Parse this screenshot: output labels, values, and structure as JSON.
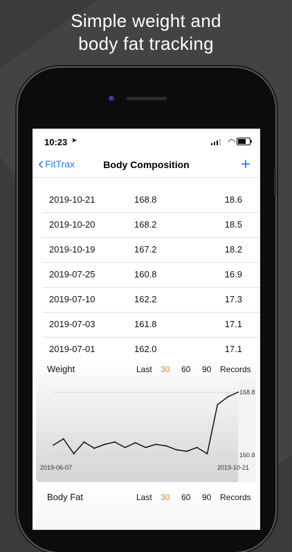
{
  "headline": {
    "line1": "Simple weight and",
    "line2": "body fat tracking"
  },
  "status_bar": {
    "time": "10:23",
    "location_icon": "location-arrow-icon",
    "signal_icon": "signal-bars-icon",
    "wifi_icon": "wifi-icon",
    "battery_icon": "battery-icon"
  },
  "nav": {
    "back_label": "FitTrax",
    "title": "Body Composition",
    "add_label": "+"
  },
  "table": {
    "rows": [
      {
        "date": "2019-10-21",
        "weight": "168.8",
        "body_fat": "18.6"
      },
      {
        "date": "2019-10-20",
        "weight": "168.2",
        "body_fat": "18.5"
      },
      {
        "date": "2019-10-19",
        "weight": "167.2",
        "body_fat": "18.2"
      },
      {
        "date": "2019-07-25",
        "weight": "160.8",
        "body_fat": "16.9"
      },
      {
        "date": "2019-07-10",
        "weight": "162.2",
        "body_fat": "17.3"
      },
      {
        "date": "2019-07-03",
        "weight": "161.8",
        "body_fat": "17.1"
      },
      {
        "date": "2019-07-01",
        "weight": "162.0",
        "body_fat": "17.1"
      }
    ]
  },
  "weight_card": {
    "title": "Weight",
    "range_label": "Last",
    "options": [
      "30",
      "60",
      "90"
    ],
    "selected": "30",
    "records_label": "Records"
  },
  "bodyfat_card": {
    "title": "Body Fat",
    "range_label": "Last",
    "options": [
      "30",
      "60",
      "90"
    ],
    "selected": "30",
    "records_label": "Records"
  },
  "colors": {
    "accent_blue": "#2f7af6",
    "selected_orange": "#e8862a"
  },
  "chart_data": {
    "type": "line",
    "title": "",
    "xlabel": "",
    "ylabel": "",
    "x_start_label": "2019-06-07",
    "x_end_label": "2019-10-21",
    "y_max_label": "168.8",
    "y_min_label": "160.8",
    "ylim": [
      160.8,
      168.8
    ],
    "series": [
      {
        "values": [
          162.0,
          162.8,
          160.9,
          162.4,
          161.6,
          162.1,
          162.4,
          161.7,
          162.3,
          161.7,
          162.1,
          161.9,
          161.4,
          161.2,
          161.7,
          160.9,
          167.2,
          168.2,
          168.8
        ]
      }
    ],
    "grid": true
  }
}
